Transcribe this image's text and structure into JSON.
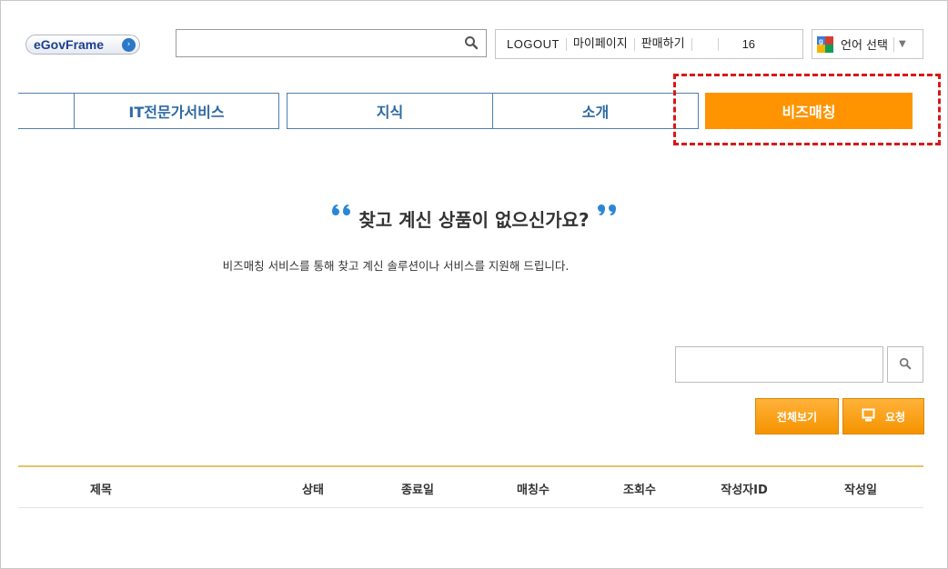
{
  "header": {
    "logo_text": "eGovFrame",
    "search": {
      "value": "",
      "placeholder": ""
    },
    "util": {
      "logout": "LOGOUT",
      "mypage": "마이페이지",
      "sell": "판매하기",
      "count": "16"
    },
    "language": {
      "label": "언어 선택"
    }
  },
  "nav": {
    "tabs": [
      {
        "label": ""
      },
      {
        "label": "IT전문가서비스"
      },
      {
        "label": "지식"
      },
      {
        "label": "소개"
      },
      {
        "label": "비즈매칭",
        "active": true
      }
    ]
  },
  "hero": {
    "title": "찾고 계신 상품이 없으신가요?",
    "subtitle": "비즈매칭 서비스를 통해 찾고 계신 솔루션이나 서비스를 지원해 드립니다."
  },
  "list": {
    "search": {
      "value": "",
      "placeholder": ""
    },
    "buttons": {
      "view_all": "전체보기",
      "request": "요청"
    },
    "columns": [
      "제목",
      "상태",
      "종료일",
      "매칭수",
      "조회수",
      "작성자ID",
      "작성일"
    ]
  },
  "colors": {
    "accent_orange": "#ff9300",
    "nav_blue": "#2e6aa3",
    "highlight_red": "#d81818",
    "table_rule": "#e5c265"
  },
  "icons": [
    "search-icon",
    "google-translate-icon",
    "dropdown-arrow-icon",
    "quote-open-icon",
    "quote-close-icon",
    "request-icon"
  ]
}
